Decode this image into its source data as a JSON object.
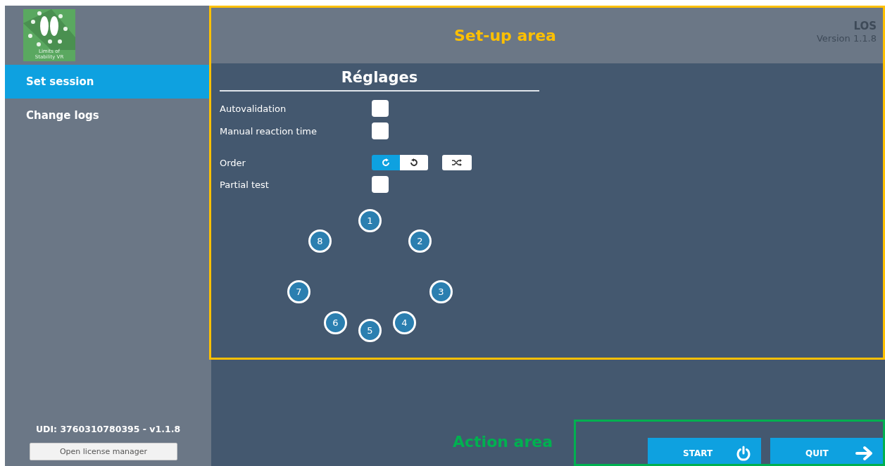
{
  "logo": {
    "text": "Limits of Stability VR"
  },
  "sidebar": {
    "items": [
      {
        "label": "Set session",
        "selected": true
      },
      {
        "label": "Change logs",
        "selected": false
      }
    ],
    "udi": "UDI: 3760310780395 - v1.1.8",
    "license_button": "Open license manager"
  },
  "header": {
    "app": "LOS",
    "version": "Version 1.1.8"
  },
  "settings": {
    "title": "Réglages",
    "rows": [
      {
        "kind": "checkbox",
        "label": "Autovalidation",
        "checked": false
      },
      {
        "kind": "checkbox",
        "label": "Manual reaction time",
        "checked": false
      },
      {
        "kind": "order",
        "label": "Order",
        "options": [
          {
            "selected": true
          },
          {
            "selected": false
          }
        ],
        "shuffle": false
      },
      {
        "kind": "checkbox",
        "label": "Partial test",
        "checked": false
      }
    ]
  },
  "targets": [
    "1",
    "2",
    "3",
    "4",
    "5",
    "6",
    "7",
    "8"
  ],
  "actions": [
    {
      "label": "START"
    },
    {
      "label": "QUIT"
    }
  ],
  "annotations": [
    {
      "label": "Set-up area",
      "color": "#ffc000"
    },
    {
      "label": "Action area",
      "color": "#00b050"
    }
  ]
}
